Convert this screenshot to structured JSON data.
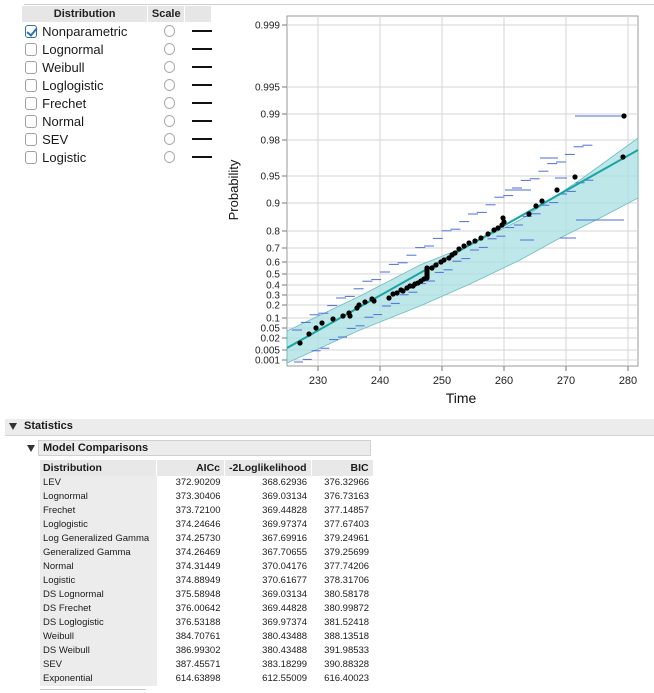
{
  "distribution_panel": {
    "col_distribution": "Distribution",
    "col_scale": "Scale",
    "items": [
      {
        "label": "Nonparametric",
        "checked": true
      },
      {
        "label": "Lognormal",
        "checked": false
      },
      {
        "label": "Weibull",
        "checked": false
      },
      {
        "label": "Loglogistic",
        "checked": false
      },
      {
        "label": "Frechet",
        "checked": false
      },
      {
        "label": "Normal",
        "checked": false
      },
      {
        "label": "SEV",
        "checked": false
      },
      {
        "label": "Logistic",
        "checked": false
      }
    ]
  },
  "colors": {
    "fit_line": "#1aa3a3",
    "band": "#a8dfe1",
    "intervals": "#4d6fd8",
    "points": "#000000"
  },
  "plot": {
    "xlabel": "Time",
    "ylabel": "Probability",
    "x_ticks": [
      "230",
      "240",
      "250",
      "260",
      "270",
      "280"
    ],
    "y_ticks": [
      "0.999",
      "0.995",
      "0.99",
      "0.98",
      "0.95",
      "0.9",
      "0.8",
      "0.7",
      "0.6",
      "0.5",
      "0.4",
      "0.3",
      "0.2",
      "0.1",
      "0.05",
      "0.02",
      "0.005",
      "0.001"
    ]
  },
  "statistics": {
    "title": "Statistics",
    "model_comparisons": {
      "title": "Model Comparisons",
      "columns": [
        "Distribution",
        "AICc",
        "-2Loglikelihood",
        "BIC"
      ],
      "rows": [
        [
          "LEV",
          "372.90209",
          "368.62936",
          "376.32966"
        ],
        [
          "Lognormal",
          "373.30406",
          "369.03134",
          "376.73163"
        ],
        [
          "Frechet",
          "373.72100",
          "369.44828",
          "377.14857"
        ],
        [
          "Loglogistic",
          "374.24646",
          "369.97374",
          "377.67403"
        ],
        [
          "Log Generalized Gamma",
          "374.25730",
          "367.69916",
          "379.24961"
        ],
        [
          "Generalized Gamma",
          "374.26469",
          "367.70655",
          "379.25699"
        ],
        [
          "Normal",
          "374.31449",
          "370.04176",
          "377.74206"
        ],
        [
          "Logistic",
          "374.88949",
          "370.61677",
          "378.31706"
        ],
        [
          "DS Lognormal",
          "375.58948",
          "369.03134",
          "380.58178"
        ],
        [
          "DS Frechet",
          "376.00642",
          "369.44828",
          "380.99872"
        ],
        [
          "DS Loglogistic",
          "376.53188",
          "369.97374",
          "381.52418"
        ],
        [
          "Weibull",
          "384.70761",
          "380.43488",
          "388.13518"
        ],
        [
          "DS Weibull",
          "386.99302",
          "380.43488",
          "391.98533"
        ],
        [
          "SEV",
          "387.45571",
          "383.18299",
          "390.88328"
        ],
        [
          "Exponential",
          "614.63898",
          "612.55009",
          "616.40023"
        ]
      ]
    }
  }
}
